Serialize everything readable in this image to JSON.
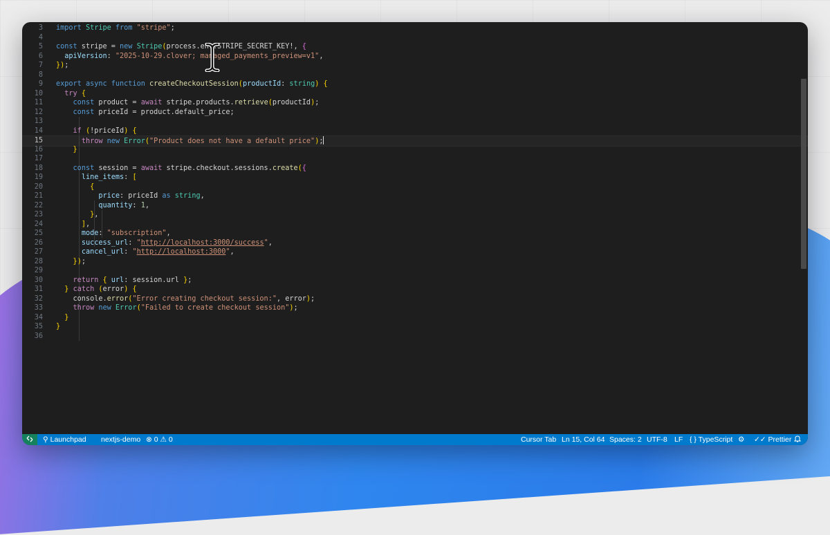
{
  "editor": {
    "lines": [
      {
        "n": "3",
        "code": "import Stripe from \"stripe\";"
      },
      {
        "n": "4",
        "code": ""
      },
      {
        "n": "5",
        "code": "const stripe = new Stripe(process.env.STRIPE_SECRET_KEY!, {"
      },
      {
        "n": "6",
        "code": "  apiVersion: \"2025-10-29.clover; managed_payments_preview=v1\","
      },
      {
        "n": "7",
        "code": "});"
      },
      {
        "n": "8",
        "code": ""
      },
      {
        "n": "9",
        "code": "export async function createCheckoutSession(productId: string) {"
      },
      {
        "n": "10",
        "code": "  try {"
      },
      {
        "n": "11",
        "code": "    const product = await stripe.products.retrieve(productId);"
      },
      {
        "n": "12",
        "code": "    const priceId = product.default_price;"
      },
      {
        "n": "13",
        "code": ""
      },
      {
        "n": "14",
        "code": "    if (!priceId) {"
      },
      {
        "n": "15",
        "code": "      throw new Error(\"Product does not have a default price\");"
      },
      {
        "n": "16",
        "code": "    }"
      },
      {
        "n": "17",
        "code": ""
      },
      {
        "n": "18",
        "code": "    const session = await stripe.checkout.sessions.create({"
      },
      {
        "n": "19",
        "code": "      line_items: ["
      },
      {
        "n": "20",
        "code": "        {"
      },
      {
        "n": "21",
        "code": "          price: priceId as string,"
      },
      {
        "n": "22",
        "code": "          quantity: 1,"
      },
      {
        "n": "23",
        "code": "        },"
      },
      {
        "n": "24",
        "code": "      ],"
      },
      {
        "n": "25",
        "code": "      mode: \"subscription\","
      },
      {
        "n": "26",
        "code": "      success_url: \"http://localhost:3000/success\","
      },
      {
        "n": "27",
        "code": "      cancel_url: \"http://localhost:3000\","
      },
      {
        "n": "28",
        "code": "    });"
      },
      {
        "n": "29",
        "code": ""
      },
      {
        "n": "30",
        "code": "    return { url: session.url };"
      },
      {
        "n": "31",
        "code": "  } catch (error) {"
      },
      {
        "n": "32",
        "code": "    console.error(\"Error creating checkout session:\", error);"
      },
      {
        "n": "33",
        "code": "    throw new Error(\"Failed to create checkout session\");"
      },
      {
        "n": "34",
        "code": "  }"
      },
      {
        "n": "35",
        "code": "}"
      },
      {
        "n": "36",
        "code": ""
      }
    ],
    "current_line": "15",
    "language": "TypeScript"
  },
  "statusbar": {
    "remote_icon": "remote-icon",
    "launchpad": "Launchpad",
    "project": "nextjs-demo",
    "errors": "0",
    "warnings": "0",
    "cursor_tab": "Cursor Tab",
    "position": "Ln 15, Col 64",
    "spaces": "Spaces: 2",
    "encoding": "UTF-8",
    "eol": "LF",
    "language_braces": "{ }",
    "language": "TypeScript",
    "prettier": "Prettier",
    "colors": {
      "bar": "#007acc",
      "remote": "#16825d"
    }
  },
  "theme": {
    "editor_bg": "#1e1e1e",
    "keyword": "#569cd6",
    "control": "#c586c0",
    "function": "#dcdcaa",
    "string": "#ce9178",
    "type": "#4ec9b0"
  }
}
